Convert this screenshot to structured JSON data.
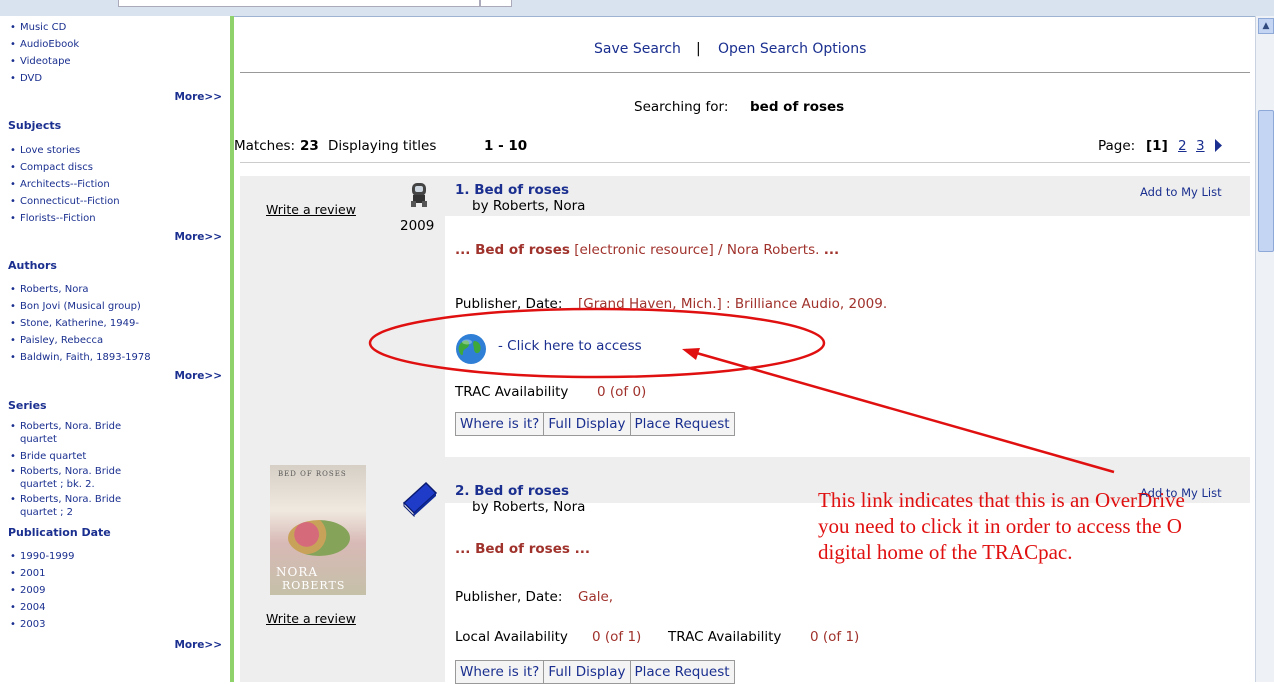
{
  "sidebar": {
    "format_items": [
      "Music CD",
      "AudioEbook",
      "Videotape",
      "DVD"
    ],
    "more_label": "More>>",
    "subjects": {
      "title": "Subjects",
      "items": [
        "Love stories",
        "Compact discs",
        "Architects--Fiction",
        "Connecticut--Fiction",
        "Florists--Fiction"
      ]
    },
    "authors": {
      "title": "Authors",
      "items": [
        "Roberts, Nora",
        "Bon Jovi (Musical group)",
        "Stone, Katherine, 1949-",
        "Paisley, Rebecca",
        "Baldwin, Faith, 1893-1978"
      ]
    },
    "series": {
      "title": "Series",
      "items": [
        "Roberts, Nora. Bride",
        "quartet",
        "Bride quartet",
        "Roberts, Nora. Bride",
        "quartet ; bk. 2.",
        "Roberts, Nora. Bride",
        "quartet ; 2"
      ]
    },
    "pubdate": {
      "title": "Publication Date",
      "items": [
        "1990-1999",
        "2001",
        "2009",
        "2004",
        "2003"
      ]
    }
  },
  "toolbar": {
    "save_search": "Save Search",
    "separator": "|",
    "open_options": "Open Search Options"
  },
  "search": {
    "searching_for_label": "Searching for:",
    "query": "bed of roses"
  },
  "results_info": {
    "matches_label": "Matches:",
    "matches": "23",
    "displaying_label": "Displaying titles",
    "range": "1 - 10",
    "page_label": "Page:",
    "current_page": "[1]",
    "pages": [
      "2",
      "3"
    ]
  },
  "results": [
    {
      "number_title": "1. Bed of roses",
      "author": "by Roberts, Nora",
      "year": "2009",
      "write_review": "Write a review",
      "add_to_list": "Add to My List",
      "snippet_pre": "... ",
      "snippet_bold": "Bed of roses",
      "snippet_rest": " [electronic resource] / Nora Roberts. ",
      "snippet_end": "...",
      "publisher_label": "Publisher, Date:",
      "publisher": "[Grand Haven, Mich.] : Brilliance Audio, 2009.",
      "access_link": "- Click here to access",
      "trac_label": "TRAC Availability",
      "trac_value": "0 (of 0)",
      "buttons": [
        "Where is it?",
        "Full Display",
        "Place Request"
      ]
    },
    {
      "number_title": "2. Bed of roses",
      "author": "by Roberts, Nora",
      "write_review": "Write a review",
      "add_to_list": "Add to My List",
      "snippet": "... Bed of roses ...",
      "publisher_label": "Publisher, Date:",
      "publisher": "Gale,",
      "local_label": "Local Availability",
      "local_value": "0 (of 1)",
      "trac_label": "TRAC Availability",
      "trac_value": "0 (of 1)",
      "buttons": [
        "Where is it?",
        "Full Display",
        "Place Request"
      ],
      "cover_title": "BED OF ROSES",
      "cover_author_1": "NORA",
      "cover_author_2": "ROBERTS"
    }
  ],
  "annotation": {
    "line1": "This link indicates that this is an OverDrive",
    "line2": "you need to click it in order to access the O",
    "line3": "digital home of the TRACpac."
  },
  "colors": {
    "accent_green": "#8fd16a",
    "link_blue": "#1a2f8f",
    "annotation_red": "#e01010",
    "meta_red": "#a0322c"
  }
}
